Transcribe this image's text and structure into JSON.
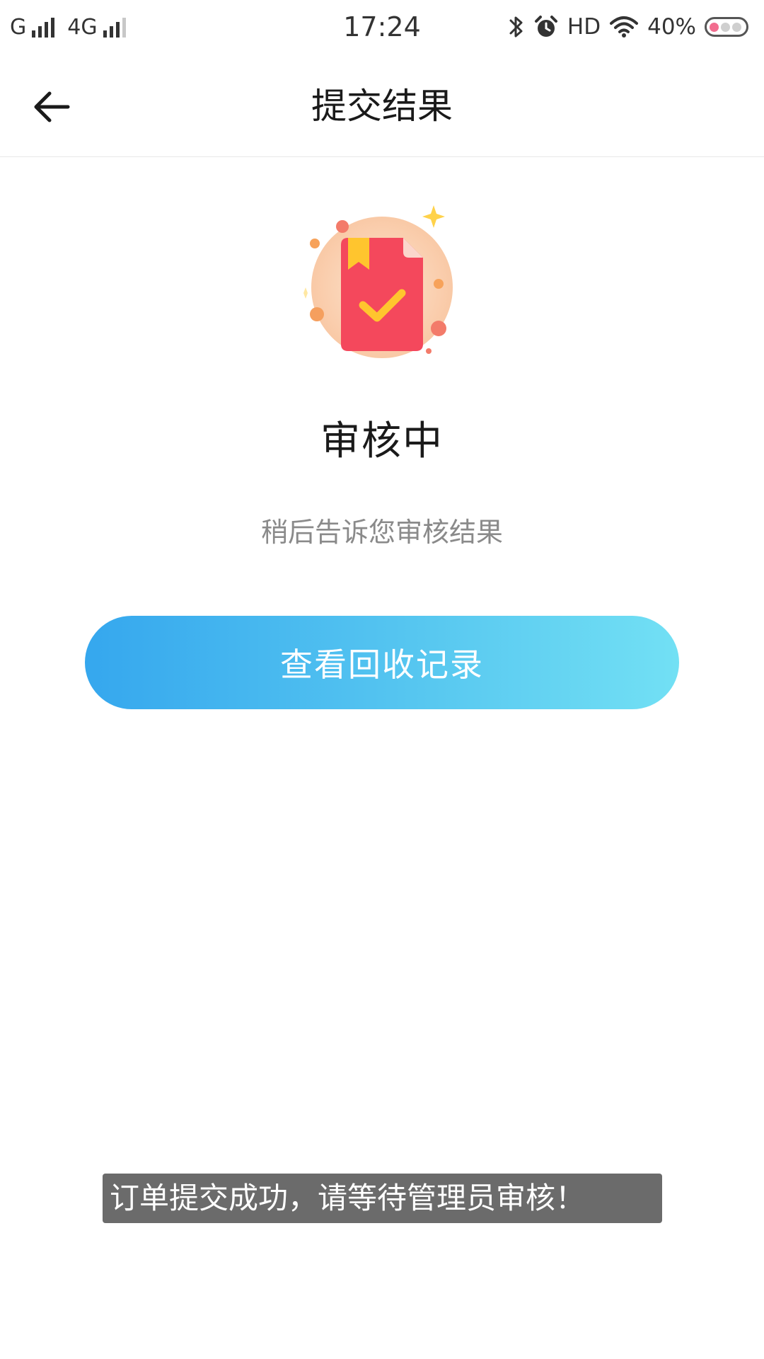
{
  "status_bar": {
    "carrier_1": "G",
    "carrier_2": "4G",
    "time": "17:24",
    "hd_label": "HD",
    "battery_percent": "40%",
    "icons": [
      "signal-icon",
      "bluetooth-icon",
      "alarm-icon",
      "wifi-icon",
      "battery-icon"
    ]
  },
  "nav": {
    "back_icon": "arrow-left-icon",
    "title": "提交结果"
  },
  "result": {
    "illustration": "document-check-icon",
    "status_title": "审核中",
    "status_subtitle": "稍后告诉您审核结果",
    "action_label": "查看回收记录"
  },
  "toast": {
    "message": "订单提交成功，请等待管理员审核！"
  },
  "colors": {
    "button_gradient_start": "#35a7ee",
    "button_gradient_end": "#72e0f4",
    "doc_red": "#f4485c",
    "circle_peach": "#fbd3b4",
    "check_yellow": "#ffc52e",
    "toast_bg": "#6b6b6b"
  }
}
